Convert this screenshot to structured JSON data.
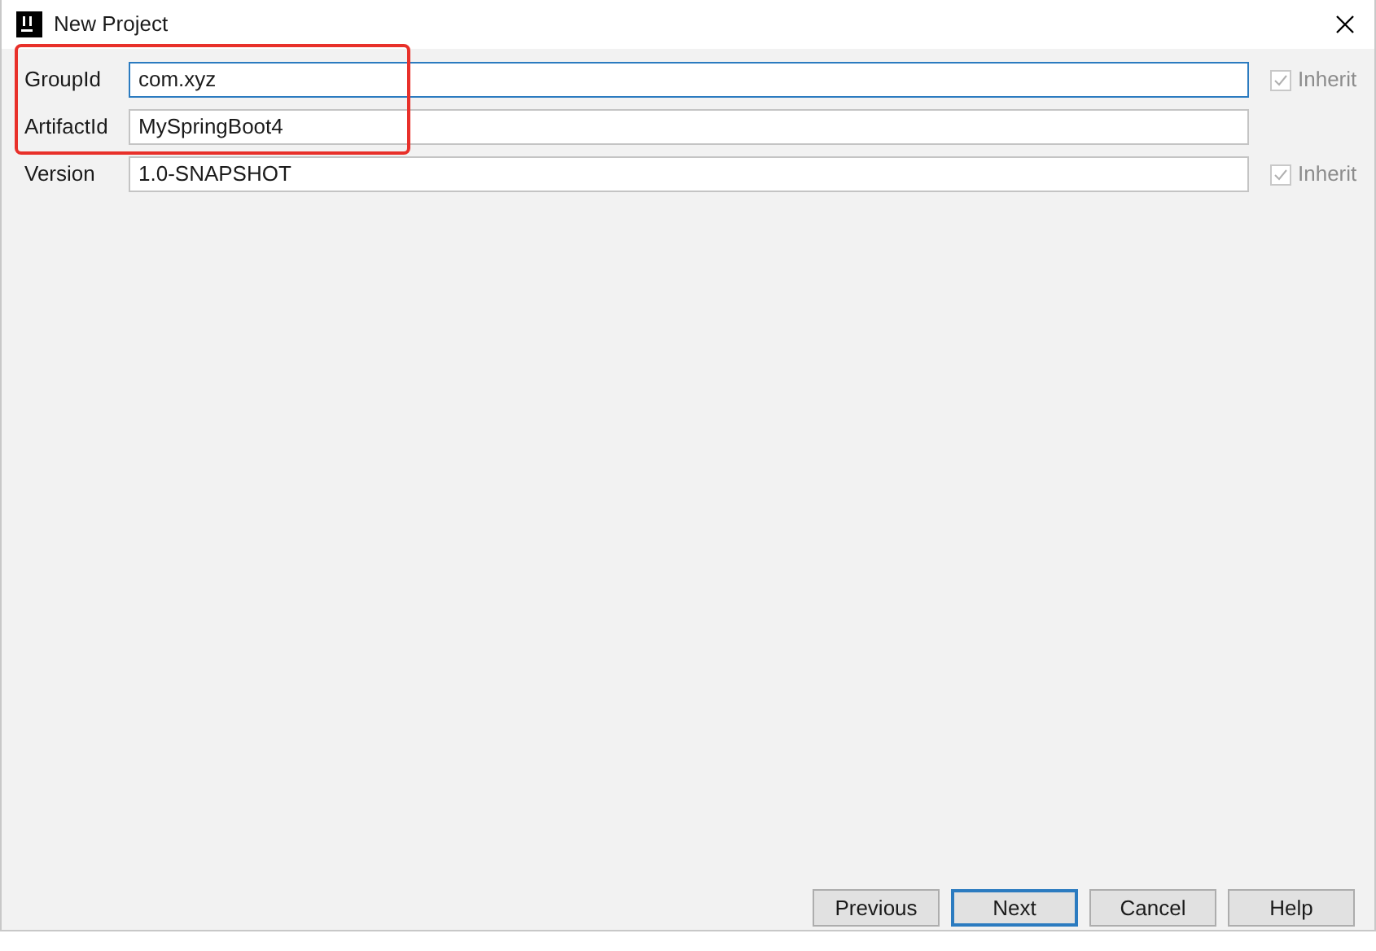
{
  "window": {
    "title": "New Project"
  },
  "field_groups": [
    {
      "highlighted": true,
      "fields": [
        {
          "label": "GroupId",
          "value": "com.xyz",
          "focused": true,
          "inherit": {
            "label": "Inherit",
            "checked": true,
            "disabled": true
          }
        },
        {
          "label": "ArtifactId",
          "value": "MySpringBoot4",
          "focused": false
        }
      ]
    },
    {
      "highlighted": false,
      "fields": [
        {
          "label": "Version",
          "value": "1.0-SNAPSHOT",
          "focused": false,
          "inherit": {
            "label": "Inherit",
            "checked": true,
            "disabled": true
          }
        }
      ]
    }
  ],
  "buttons": [
    {
      "label": "Previous",
      "default": false
    },
    {
      "label": "Next",
      "default": true
    },
    {
      "label": "Cancel",
      "default": false
    },
    {
      "label": "Help",
      "default": false
    }
  ]
}
